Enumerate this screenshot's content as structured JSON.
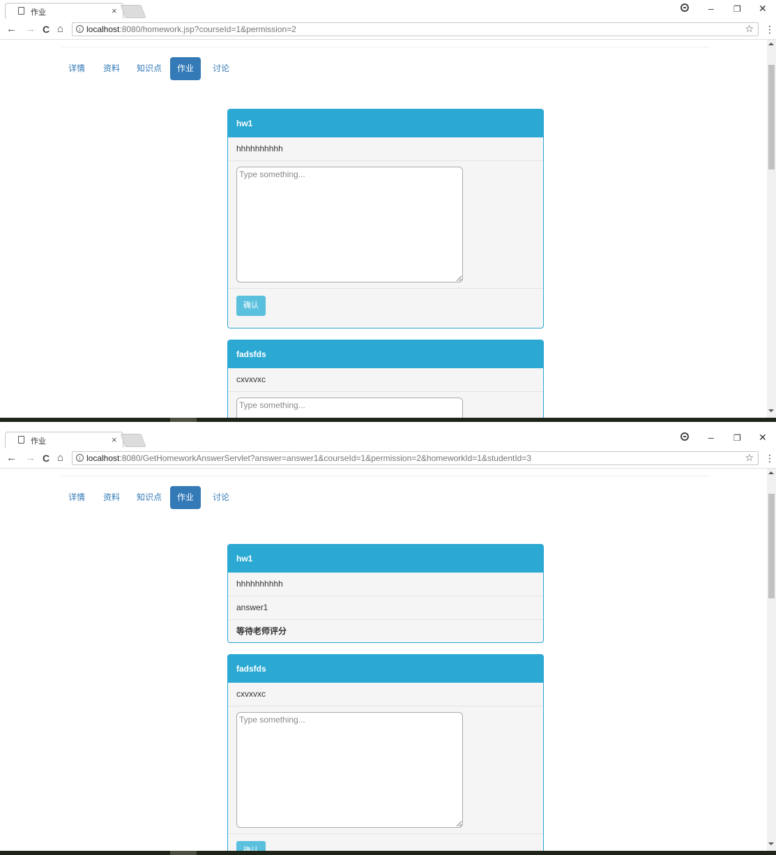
{
  "browser": {
    "tab_title": "作业",
    "close_glyph": "×",
    "nav": {
      "back": "←",
      "forward": "→",
      "reload": "C",
      "home": "⌂"
    },
    "star": "☆",
    "menu": "⋮",
    "window": {
      "minimize": "–",
      "restore": "❐",
      "close": "✕"
    }
  },
  "screenshot1": {
    "url_host": "localhost",
    "url_rest": ":8080/homework.jsp?courseId=1&permission=2"
  },
  "screenshot2": {
    "url_host": "localhost",
    "url_rest": ":8080/GetHomeworkAnswerServlet?answer=answer1&courseId=1&permission=2&homeworkId=1&studentId=3"
  },
  "nav_pills": [
    "详情",
    "资料",
    "知识点",
    "作业",
    "讨论"
  ],
  "active_pill": "作业",
  "homework": [
    {
      "title": "hw1",
      "description": "hhhhhhhhhh",
      "placeholder": "Type something...",
      "submit_label": "确认",
      "answer": "answer1",
      "status": "等待老师评分"
    },
    {
      "title": "fadsfds",
      "description": "cxvxvxc",
      "placeholder": "Type something...",
      "submit_label": "确认"
    }
  ],
  "colors": {
    "panel_heading": "#2ba9d3",
    "pill_active": "#337ab7",
    "button": "#5bc0de"
  }
}
